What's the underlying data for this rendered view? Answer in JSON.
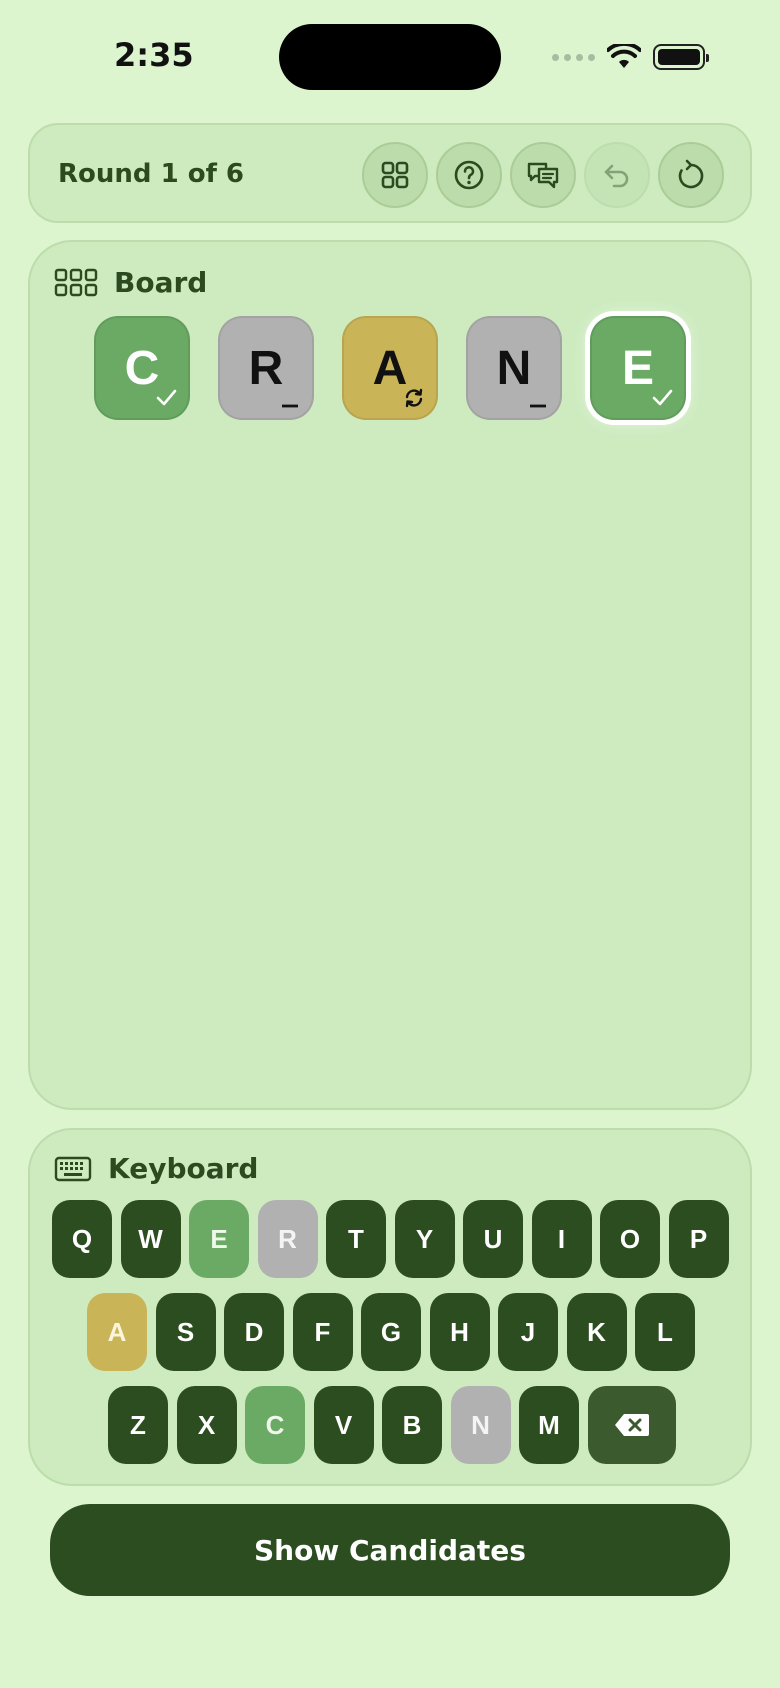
{
  "status": {
    "time": "2:35"
  },
  "header": {
    "round_label": "Round 1 of 6",
    "buttons": [
      {
        "name": "grid-view-button",
        "icon": "grid-icon",
        "enabled": true
      },
      {
        "name": "help-button",
        "icon": "question-icon",
        "enabled": true
      },
      {
        "name": "feedback-button",
        "icon": "chat-bubbles-icon",
        "enabled": true
      },
      {
        "name": "undo-button",
        "icon": "undo-icon",
        "enabled": false
      },
      {
        "name": "reset-button",
        "icon": "reset-icon",
        "enabled": true
      }
    ]
  },
  "board": {
    "title": "Board",
    "icon": "grid-3x2-icon",
    "tiles": [
      {
        "letter": "C",
        "state": "correct",
        "mark": "check"
      },
      {
        "letter": "R",
        "state": "absent",
        "mark": "underscore"
      },
      {
        "letter": "A",
        "state": "present",
        "mark": "swap"
      },
      {
        "letter": "N",
        "state": "absent",
        "mark": "underscore"
      },
      {
        "letter": "E",
        "state": "correct",
        "mark": "check",
        "selected": true
      }
    ]
  },
  "keyboard": {
    "title": "Keyboard",
    "icon": "keyboard-icon",
    "rows": [
      [
        {
          "label": "Q",
          "state": "unused"
        },
        {
          "label": "W",
          "state": "unused"
        },
        {
          "label": "E",
          "state": "correct"
        },
        {
          "label": "R",
          "state": "absent"
        },
        {
          "label": "T",
          "state": "unused"
        },
        {
          "label": "Y",
          "state": "unused"
        },
        {
          "label": "U",
          "state": "unused"
        },
        {
          "label": "I",
          "state": "unused"
        },
        {
          "label": "O",
          "state": "unused"
        },
        {
          "label": "P",
          "state": "unused"
        }
      ],
      [
        {
          "label": "A",
          "state": "present"
        },
        {
          "label": "S",
          "state": "unused"
        },
        {
          "label": "D",
          "state": "unused"
        },
        {
          "label": "F",
          "state": "unused"
        },
        {
          "label": "G",
          "state": "unused"
        },
        {
          "label": "H",
          "state": "unused"
        },
        {
          "label": "J",
          "state": "unused"
        },
        {
          "label": "K",
          "state": "unused"
        },
        {
          "label": "L",
          "state": "unused"
        }
      ],
      [
        {
          "label": "Z",
          "state": "unused"
        },
        {
          "label": "X",
          "state": "unused"
        },
        {
          "label": "C",
          "state": "correct"
        },
        {
          "label": "V",
          "state": "unused"
        },
        {
          "label": "B",
          "state": "unused"
        },
        {
          "label": "N",
          "state": "absent"
        },
        {
          "label": "M",
          "state": "unused"
        }
      ]
    ],
    "backspace_icon": "backspace-icon"
  },
  "cta": {
    "label": "Show Candidates"
  },
  "colors": {
    "background": "#dcf5cf",
    "panel": "#cdebbf",
    "dark_green": "#2b4d1f",
    "correct": "#6aaa64",
    "present": "#c9b458",
    "absent": "#b1b1b1"
  }
}
